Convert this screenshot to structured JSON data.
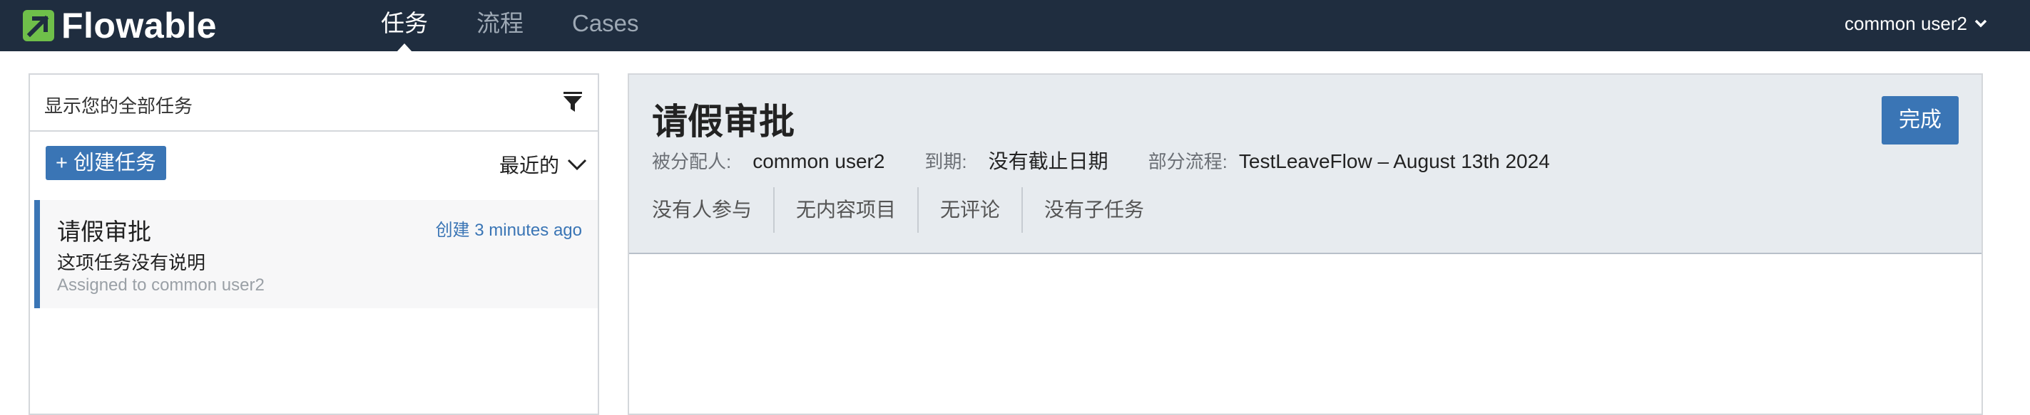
{
  "header": {
    "logo_text": "Flowable",
    "logo_color": "#6fbf4a",
    "nav": [
      {
        "label": "任务",
        "active": true
      },
      {
        "label": "流程",
        "active": false
      },
      {
        "label": "Cases",
        "active": false
      }
    ],
    "user": "common user2",
    "user_icon": "chevron-down-icon"
  },
  "task_list": {
    "filter_text": "显示您的全部任务",
    "filter_icon": "filter-icon",
    "create_button": "+ 创建任务",
    "sort_label": "最近的",
    "items": [
      {
        "title": "请假审批",
        "created": "创建 3 minutes ago",
        "description": "这项任务没有说明",
        "assigned": "Assigned to common user2"
      }
    ]
  },
  "task_detail": {
    "title": "请假审批",
    "complete_button": "完成",
    "assignee_label": "被分配人:",
    "assignee_value": "common user2",
    "due_label": "到期:",
    "due_value": "没有截止日期",
    "process_label": "部分流程:",
    "process_value": "TestLeaveFlow – August 13th 2024",
    "tabs": [
      "没有人参与",
      "无内容项目",
      "无评论",
      "没有子任务"
    ]
  },
  "colors": {
    "header_bg": "#1f2d3f",
    "accent": "#3a75b5",
    "detail_bg": "#e7ebef"
  }
}
